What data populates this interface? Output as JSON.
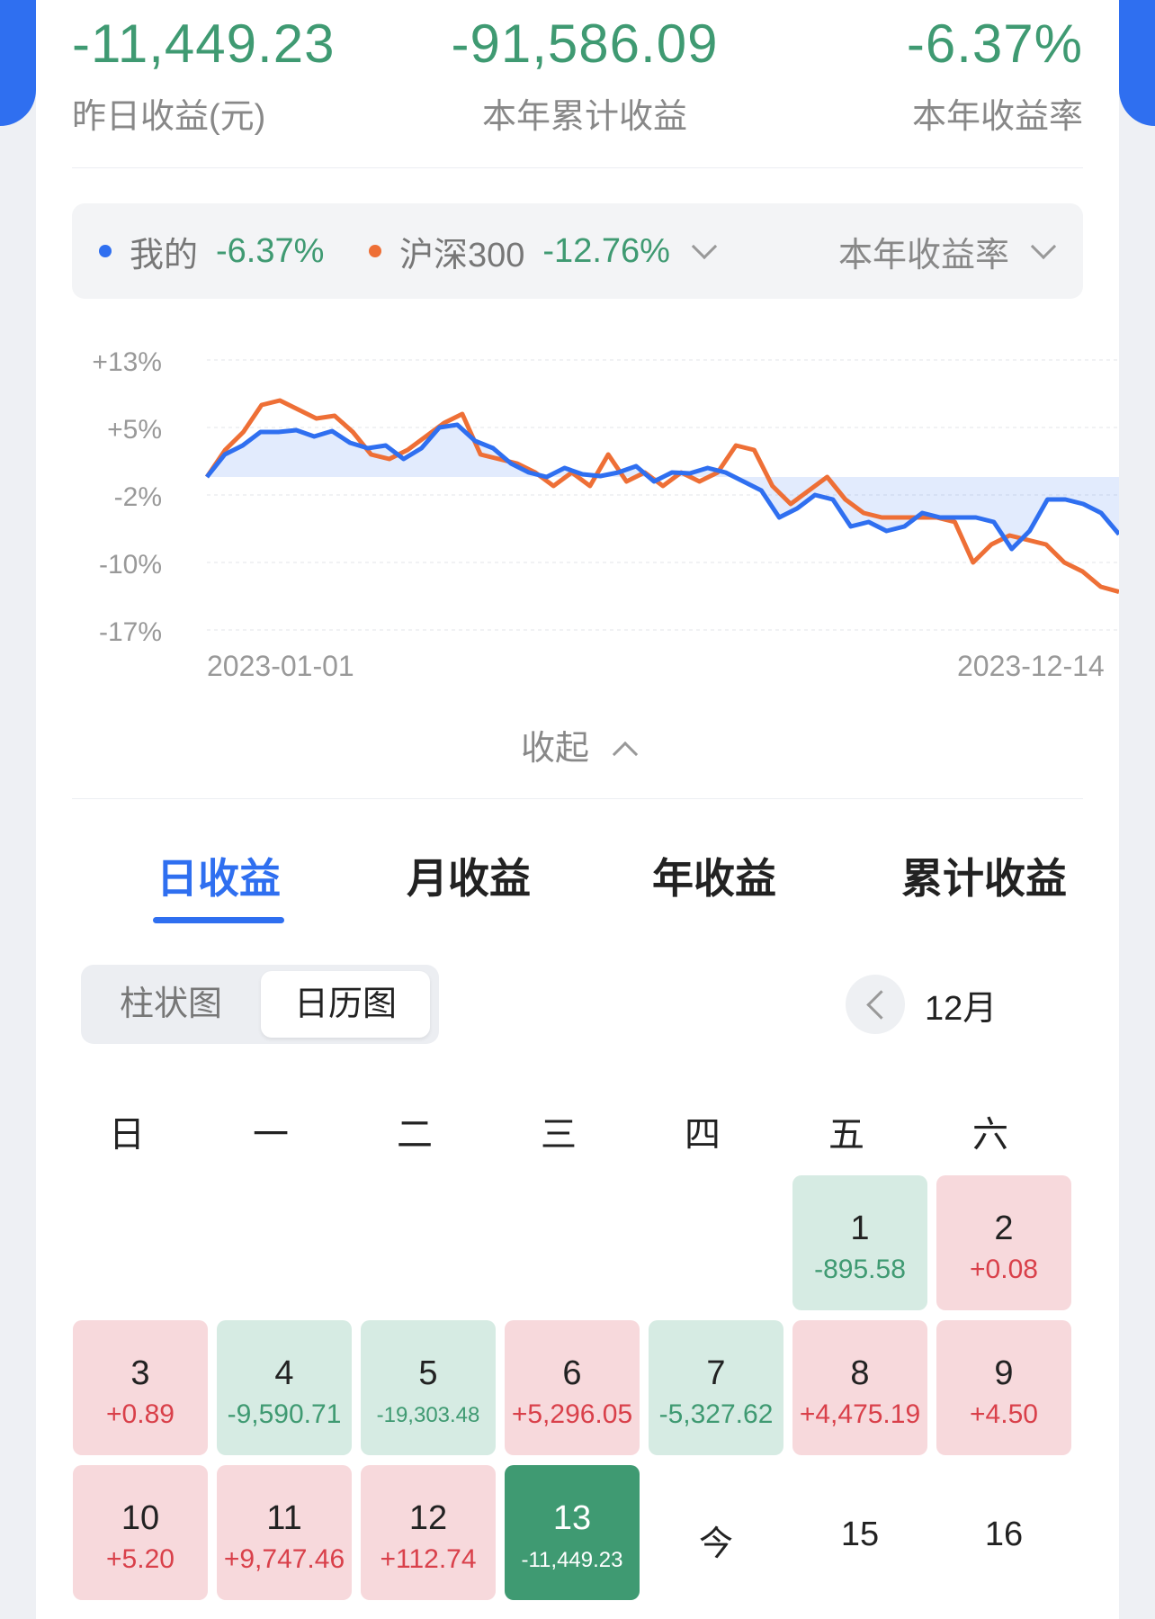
{
  "summary": {
    "yesterday_value": "-11,449.23",
    "yesterday_label": "昨日收益(元)",
    "ytd_value": "-91,586.09",
    "ytd_label": "本年累计收益",
    "rate_value": "-6.37%",
    "rate_label": "本年收益率"
  },
  "compare": {
    "mine_name": "我的",
    "mine_pct": "-6.37%",
    "bench_name": "沪深300",
    "bench_pct": "-12.76%",
    "metric": "本年收益率"
  },
  "colors": {
    "mine": "#2f6ff0",
    "bench": "#ee6f36",
    "loss": "#3f9a72",
    "gain": "#d9404a"
  },
  "chart_data": {
    "type": "line",
    "y_ticks": [
      "+13%",
      "+5%",
      "-2%",
      "-10%",
      "-17%"
    ],
    "ylim": [
      -17,
      13
    ],
    "x_ticks": [
      "2023-01-01",
      "2023-12-14"
    ],
    "series": [
      {
        "name": "我的",
        "values": [
          0,
          2.5,
          3.5,
          5,
          5,
          5.2,
          4.5,
          5.1,
          3.8,
          3.2,
          3.5,
          2,
          3.2,
          5.5,
          5.8,
          4,
          3.2,
          1.5,
          0.5,
          0,
          1,
          0.3,
          0.1,
          0.5,
          1.2,
          -0.5,
          0.5,
          0.4,
          1,
          0.5,
          -0.5,
          -1.5,
          -4.5,
          -3.5,
          -2,
          -2.5,
          -5.5,
          -5,
          -6,
          -5.5,
          -4,
          -4.5,
          -4.5,
          -4.5,
          -5,
          -8,
          -6,
          -2.5,
          -2.5,
          -3,
          -4,
          -6.37
        ]
      },
      {
        "name": "沪深300",
        "values": [
          0,
          3,
          5,
          8,
          8.5,
          7.5,
          6.5,
          6.8,
          5,
          2.5,
          2,
          3,
          4.5,
          6,
          7,
          2.5,
          2,
          1.5,
          0.5,
          -1,
          0.5,
          -1,
          2.5,
          -0.5,
          0.5,
          -1,
          0.5,
          -0.5,
          0.5,
          3.5,
          3,
          -1,
          -3,
          -1.5,
          0,
          -2.5,
          -4,
          -4.5,
          -4.5,
          -4.5,
          -4.5,
          -5,
          -9.5,
          -7.5,
          -6.5,
          -7,
          -7.5,
          -9.5,
          -10.5,
          -12.2,
          -12.76
        ]
      }
    ]
  },
  "collapse_label": "收起",
  "tabs": [
    "日收益",
    "月收益",
    "年收益",
    "累计收益"
  ],
  "view_toggle": [
    "柱状图",
    "日历图"
  ],
  "month": "12月",
  "weekdays": [
    "日",
    "一",
    "二",
    "三",
    "四",
    "五",
    "六"
  ],
  "calendar": [
    {
      "day": "1",
      "value": "-895.58"
    },
    {
      "day": "2",
      "value": "+0.08"
    },
    {
      "day": "3",
      "value": "+0.89"
    },
    {
      "day": "4",
      "value": "-9,590.71"
    },
    {
      "day": "5",
      "value": "-19,303.48"
    },
    {
      "day": "6",
      "value": "+5,296.05"
    },
    {
      "day": "7",
      "value": "-5,327.62"
    },
    {
      "day": "8",
      "value": "+4,475.19"
    },
    {
      "day": "9",
      "value": "+4.50"
    },
    {
      "day": "10",
      "value": "+5.20"
    },
    {
      "day": "11",
      "value": "+9,747.46"
    },
    {
      "day": "12",
      "value": "+112.74"
    },
    {
      "day": "13",
      "value": "-11,449.23"
    },
    {
      "day": "今",
      "value": ""
    },
    {
      "day": "15",
      "value": ""
    },
    {
      "day": "16",
      "value": ""
    }
  ]
}
